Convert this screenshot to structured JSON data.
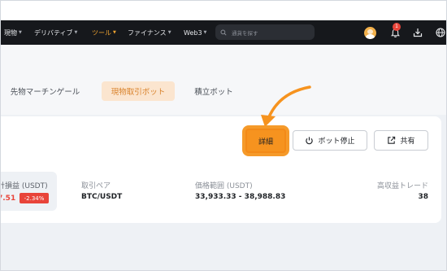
{
  "nav": {
    "items": [
      {
        "label": "現物",
        "active": false
      },
      {
        "label": "デリバティブ",
        "active": false
      },
      {
        "label": "ツール",
        "active": true
      },
      {
        "label": "ファイナンス",
        "active": false
      },
      {
        "label": "Web3",
        "active": false
      }
    ],
    "search_placeholder": "通貨を探す",
    "notification_count": "1"
  },
  "tabs": [
    {
      "label": "先物マーチンゲール",
      "active": false
    },
    {
      "label": "現物取引ボット",
      "active": true
    },
    {
      "label": "積立ボット",
      "active": false
    }
  ],
  "card": {
    "detail_label": "詳細",
    "stop_bot_label": "ボット停止",
    "share_label": "共有",
    "pnl": {
      "label": "計損益 (USDT)",
      "value": "7.51",
      "percent": "-2.34%"
    },
    "pair": {
      "label": "取引ペア",
      "value": "BTC/USDT"
    },
    "price_range": {
      "label": "価格範囲 (USDT)",
      "value": "33,933.33 - 38,988.83"
    },
    "high_yield": {
      "label": "高収益トレード",
      "value": "38"
    }
  },
  "colors": {
    "accent": "#f6931f",
    "active_tab_bg": "#fbe5cf",
    "active_tab_text": "#d9822b",
    "loss": "#e8443a",
    "navbar": "#16181c"
  }
}
